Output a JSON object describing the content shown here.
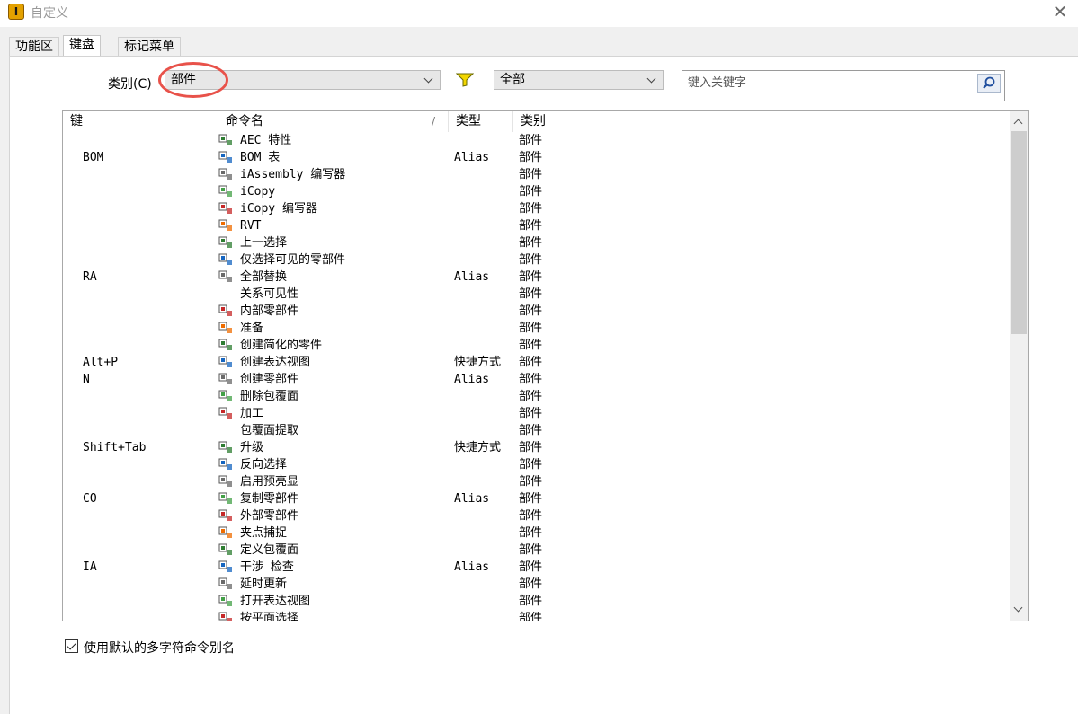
{
  "window": {
    "title": "自定义",
    "app_icon_letter": "I"
  },
  "tabs": [
    {
      "label": "功能区",
      "active": false
    },
    {
      "label": "键盘",
      "active": true
    },
    {
      "label": "标记菜单",
      "active": false
    }
  ],
  "category": {
    "label": "类别(C)",
    "value": "部件"
  },
  "filter": {
    "value": "全部",
    "icon": "filter-funnel-icon",
    "icon_color": "#f2d600"
  },
  "search": {
    "placeholder": "键入关键字",
    "icon": "magnifier-icon"
  },
  "columns": {
    "key": "键",
    "command": "命令名",
    "sort": "/",
    "type": "类型",
    "category": "类别"
  },
  "rows": [
    {
      "key": "",
      "name": "AEC 特性",
      "type": "",
      "category": "部件",
      "icon": "aec-properties-icon"
    },
    {
      "key": "BOM",
      "name": "BOM 表",
      "type": "Alias",
      "category": "部件",
      "icon": "bom-table-icon"
    },
    {
      "key": "",
      "name": "iAssembly 编写器",
      "type": "",
      "category": "部件",
      "icon": "iassembly-author-icon"
    },
    {
      "key": "",
      "name": "iCopy",
      "type": "",
      "category": "部件",
      "icon": "icopy-icon"
    },
    {
      "key": "",
      "name": "iCopy 编写器",
      "type": "",
      "category": "部件",
      "icon": "icopy-author-icon"
    },
    {
      "key": "",
      "name": "RVT",
      "type": "",
      "category": "部件",
      "icon": "rvt-icon"
    },
    {
      "key": "",
      "name": "上一选择",
      "type": "",
      "category": "部件",
      "icon": "previous-selection-icon"
    },
    {
      "key": "",
      "name": "仅选择可见的零部件",
      "type": "",
      "category": "部件",
      "icon": "select-visible-icon"
    },
    {
      "key": "RA",
      "name": "全部替换",
      "type": "Alias",
      "category": "部件",
      "icon": "replace-all-icon"
    },
    {
      "key": "",
      "name": "关系可见性",
      "type": "",
      "category": "部件",
      "icon": ""
    },
    {
      "key": "",
      "name": "内部零部件",
      "type": "",
      "category": "部件",
      "icon": "internal-components-icon"
    },
    {
      "key": "",
      "name": "准备",
      "type": "",
      "category": "部件",
      "icon": "prepare-icon"
    },
    {
      "key": "",
      "name": "创建简化的零件",
      "type": "",
      "category": "部件",
      "icon": "simplified-part-icon"
    },
    {
      "key": "Alt+P",
      "name": "创建表达视图",
      "type": "快捷方式",
      "category": "部件",
      "icon": "presentation-view-icon"
    },
    {
      "key": "N",
      "name": "创建零部件",
      "type": "Alias",
      "category": "部件",
      "icon": "create-component-icon"
    },
    {
      "key": "",
      "name": "删除包覆面",
      "type": "",
      "category": "部件",
      "icon": "delete-shrinkwrap-icon"
    },
    {
      "key": "",
      "name": "加工",
      "type": "",
      "category": "部件",
      "icon": "machining-icon"
    },
    {
      "key": "",
      "name": "包覆面提取",
      "type": "",
      "category": "部件",
      "icon": ""
    },
    {
      "key": "Shift+Tab",
      "name": "升级",
      "type": "快捷方式",
      "category": "部件",
      "icon": "promote-icon"
    },
    {
      "key": "",
      "name": "反向选择",
      "type": "",
      "category": "部件",
      "icon": "invert-selection-icon"
    },
    {
      "key": "",
      "name": "启用预亮显",
      "type": "",
      "category": "部件",
      "icon": "prehighlight-icon"
    },
    {
      "key": "CO",
      "name": "复制零部件",
      "type": "Alias",
      "category": "部件",
      "icon": "copy-components-icon"
    },
    {
      "key": "",
      "name": "外部零部件",
      "type": "",
      "category": "部件",
      "icon": "external-components-icon"
    },
    {
      "key": "",
      "name": "夹点捕捉",
      "type": "",
      "category": "部件",
      "icon": "grip-snap-icon"
    },
    {
      "key": "",
      "name": "定义包覆面",
      "type": "",
      "category": "部件",
      "icon": "define-envelope-icon"
    },
    {
      "key": "IA",
      "name": "干涉 检查",
      "type": "Alias",
      "category": "部件",
      "icon": "interference-check-icon"
    },
    {
      "key": "",
      "name": "延时更新",
      "type": "",
      "category": "部件",
      "icon": "deferred-update-icon"
    },
    {
      "key": "",
      "name": "打开表达视图",
      "type": "",
      "category": "部件",
      "icon": "open-presentation-icon"
    },
    {
      "key": "",
      "name": "按平面选择",
      "type": "",
      "category": "部件",
      "icon": "select-by-plane-icon"
    }
  ],
  "option": {
    "label": "使用默认的多字符命令别名",
    "checked": true
  }
}
